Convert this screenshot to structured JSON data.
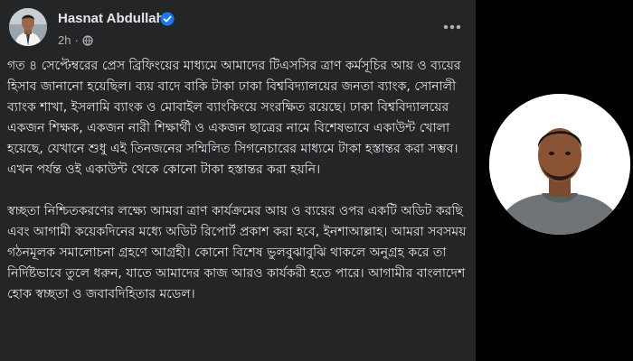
{
  "post": {
    "author_name": "Hasnat Abdullah",
    "timestamp": "2h",
    "audience_icon": "globe-icon",
    "verified_icon": "verified-badge-icon",
    "more_icon": "more-options-icon",
    "paragraphs": [
      "গত ৪ সেপ্টেম্বরের প্রেস ব্রিফিংয়ের মাধ্যমে আমাদের টিএসসির ত্রাণ কর্মসূচির আয় ও ব্যয়ের হিসাব জানানো হয়েছিল। ব্যয় বাদে বাকি টাকা ঢাকা বিশ্ববিদ্যালয়ের জনতা ব্যাংক, সোনালী ব্যাংক শাখা, ইসলামি ব্যাংক ও মোবাইল ব্যাংকিংয়ে সংরক্ষিত রয়েছে। ঢাকা বিশ্ববিদ্যালয়ের একজন শিক্ষক, একজন নারী শিক্ষার্থী ও একজন ছাত্রের নামে বিশেষভাবে একাউন্ট খোলা হয়েছে, যেখানে শুধু এই তিনজনের সম্মিলিত সিগনেচারের মাধ্যমে টাকা হস্তান্তর করা সম্ভব। এখন পর্যন্ত ওই একাউন্ট থেকে কোনো টাকা হস্তান্তর করা হয়নি।",
      "স্বচ্ছতা নিশ্চিতকরণের লক্ষ্যে আমরা ত্রাণ কার্যক্রমের আয় ও ব্যয়ের ওপর একটি অডিট করছি এবং আগামী কয়েকদিনের মধ্যে অডিট রিপোর্ট প্রকাশ করা হবে, ইনশাআল্লাহ। আমরা সবসময় গঠনমূলক সমালোচনা গ্রহণে আগ্রহী। কোনো বিশেষ ভুলবুঝাবুঝি থাকলে অনুগ্রহ করে তা নির্দিষ্টভাবে তুলে ধরুন, যাতে আমাদের কাজ আরও কার্যকরী হতে পারে। আগামীর বাংলাদেশ হোক স্বচ্ছতা ও জবাবদিহিতার মডেল।"
    ]
  },
  "colors": {
    "card_background": "#242526",
    "outer_background": "#000000",
    "primary_text": "#e4e6eb",
    "secondary_text": "#b0b3b8",
    "verified_blue": "#1877f2"
  }
}
